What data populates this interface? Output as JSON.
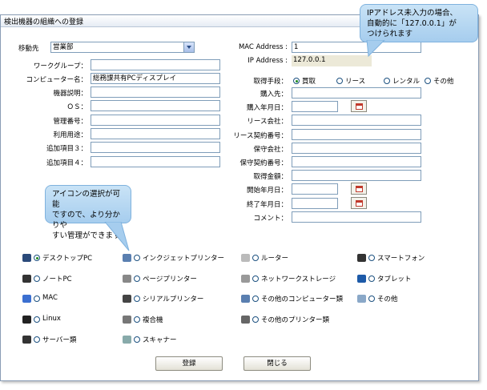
{
  "window": {
    "title": "検出機器の組織への登録"
  },
  "left": {
    "destination_label": "移動先",
    "destination_value": "営業部",
    "fields": [
      {
        "label": "ワークグループ：",
        "value": ""
      },
      {
        "label": "コンピューター名：",
        "value": "総務課共有PCディスプレイ"
      },
      {
        "label": "機器説明：",
        "value": ""
      },
      {
        "label": "ＯＳ：",
        "value": ""
      },
      {
        "label": "管理番号：",
        "value": ""
      },
      {
        "label": "利用用途：",
        "value": ""
      },
      {
        "label": "追加項目３：",
        "value": ""
      },
      {
        "label": "追加項目４：",
        "value": ""
      }
    ]
  },
  "right": {
    "mac_label": "MAC Address :",
    "mac_value": "1",
    "ip_label": "IP Address :",
    "ip_value": "127.0.0.1",
    "acq_label": "取得手段：",
    "acq_options": [
      {
        "label": "買取",
        "selected": true
      },
      {
        "label": "リース",
        "selected": false
      },
      {
        "label": "レンタル",
        "selected": false
      },
      {
        "label": "その他",
        "selected": false
      }
    ],
    "fields": [
      {
        "label": "購入先：",
        "value": ""
      },
      {
        "label": "購入年月日：",
        "value": ""
      },
      {
        "label": "リース会社：",
        "value": ""
      },
      {
        "label": "リース契約番号：",
        "value": ""
      },
      {
        "label": "保守会社：",
        "value": ""
      },
      {
        "label": "保守契約番号：",
        "value": ""
      },
      {
        "label": "取得金額：",
        "value": ""
      },
      {
        "label": "開始年月日：",
        "value": ""
      },
      {
        "label": "終了年月日：",
        "value": ""
      },
      {
        "label": "コメント：",
        "value": ""
      }
    ]
  },
  "device_types": {
    "col1": [
      {
        "label": "デスクトップPC",
        "icon": "desktop-pc-icon",
        "selected": true
      },
      {
        "label": "ノートPC",
        "icon": "laptop-icon",
        "selected": false
      },
      {
        "label": "MAC",
        "icon": "apple-icon",
        "selected": false
      },
      {
        "label": "Linux",
        "icon": "linux-penguin-icon",
        "selected": false
      },
      {
        "label": "サーバー類",
        "icon": "server-icon",
        "selected": false
      }
    ],
    "col2": [
      {
        "label": "インクジェットプリンター",
        "icon": "inkjet-printer-icon",
        "selected": false
      },
      {
        "label": "ページプリンター",
        "icon": "page-printer-icon",
        "selected": false
      },
      {
        "label": "シリアルプリンター",
        "icon": "serial-printer-icon",
        "selected": false
      },
      {
        "label": "複合機",
        "icon": "multifunction-icon",
        "selected": false
      },
      {
        "label": "スキャナー",
        "icon": "scanner-icon",
        "selected": false
      }
    ],
    "col3": [
      {
        "label": "ルーター",
        "icon": "router-icon",
        "selected": false
      },
      {
        "label": "ネットワークストレージ",
        "icon": "nas-icon",
        "selected": false
      },
      {
        "label": "その他のコンピューター類",
        "icon": "other-computer-icon",
        "selected": false
      },
      {
        "label": "その他のプリンター類",
        "icon": "other-printer-icon",
        "selected": false
      }
    ],
    "col4": [
      {
        "label": "スマートフォン",
        "icon": "smartphone-icon",
        "selected": false
      },
      {
        "label": "タブレット",
        "icon": "tablet-icon",
        "selected": false
      },
      {
        "label": "その他",
        "icon": "gear-icon",
        "selected": false
      }
    ]
  },
  "buttons": {
    "register": "登録",
    "close": "閉じる"
  },
  "callouts": {
    "ip_note": [
      "IPアドレス未入力の場合、",
      "自動的に「127.0.0.1」が",
      "つけられます"
    ],
    "icon_note": [
      "アイコンの選択が可能",
      "ですので、より分かりや",
      "すい管理ができます"
    ]
  }
}
